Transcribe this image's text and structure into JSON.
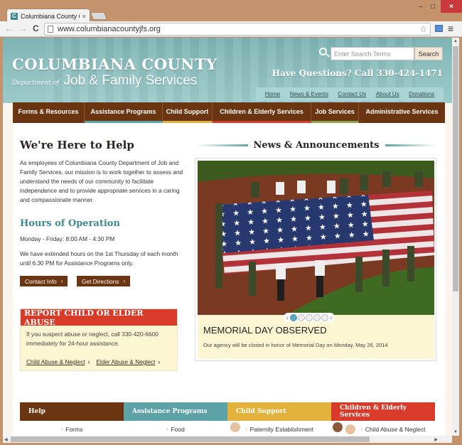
{
  "browser": {
    "tab_title": "Columbiana County Ohio",
    "tab_favicon": "C",
    "close_glyph": "×",
    "url": "www.columbianacountyjfs.org",
    "back_glyph": "←",
    "forward_glyph": "→",
    "reload_glyph": "C",
    "star_glyph": "☆",
    "menu_glyph": "≡",
    "min_glyph": "–",
    "max_glyph": "□",
    "winclose_glyph": "×",
    "icons": [
      "back-icon",
      "forward-icon",
      "reload-icon",
      "page-icon",
      "star-icon",
      "extension-icon",
      "menu-icon"
    ]
  },
  "header": {
    "title": "COLUMBIANA COUNTY",
    "subtitle_small": "Department of",
    "subtitle_large": "Job & Family Services",
    "search_placeholder": "Enter Search Terms",
    "search_button": "Search",
    "phone": "Have Questions? Call 330-424-1471",
    "utility_nav": [
      "Home",
      "News & Events",
      "Contact Us",
      "About Us",
      "Donations"
    ]
  },
  "main_nav": [
    {
      "label": "Forms & Resources",
      "accent": "#6a3510"
    },
    {
      "label": "Assistance Programs",
      "accent": "#5da2a6"
    },
    {
      "label": "Child Support",
      "accent": "#e3b23c"
    },
    {
      "label": "Children & Elderly Services",
      "accent": "#d93b2a"
    },
    {
      "label": "Job Services",
      "accent": "#8aa64a"
    },
    {
      "label": "Administrative Services",
      "accent": "#6a3510"
    }
  ],
  "help": {
    "title": "We're Here to Help",
    "text": "As employees of Columbiana County Department of Job and Family Services, our mission is to work together to assess and understand the needs of our community to facilitate independence and to provide appropriate services in a caring and compassionate manner."
  },
  "hours": {
    "title": "Hours of Operation",
    "schedule": "Monday - Friday: 8:00 AM - 4:30 PM",
    "extended": "We have extended hours on the 1st Thursday of each month until 6:30 PM for Assistance Programs only.",
    "buttons": [
      "Contact Info",
      "Get Directions"
    ],
    "chevron": "›"
  },
  "abuse": {
    "title": "REPORT CHILD OR ELDER ABUSE",
    "text": "If you suspect abuse or neglect, call 330-420-6600 immediately for 24-hour assistance.",
    "links": [
      "Child Abuse & Neglect",
      "Elder Abuse & Neglect"
    ],
    "chevron": "›"
  },
  "news": {
    "title": "News & Announcements",
    "slide_title": "MEMORIAL DAY OBSERVED",
    "slide_text": "Our agency will be closed in honor of Memorial Day on Monday, May 26, 2014",
    "slide_count": 5,
    "active_slide": 1,
    "prev_glyph": "‹",
    "next_glyph": "›",
    "image_description": "Service members and sailors holding a large American flag on a baseball field"
  },
  "quick_links": [
    {
      "heading": "Help",
      "color": "#6a3510",
      "item": "Forms"
    },
    {
      "heading": "Assistance Programs",
      "color": "#5da2a6",
      "item": "Food"
    },
    {
      "heading": "Child Support",
      "color": "#e3b23c",
      "item": "Paternity Establishment"
    },
    {
      "heading": "Children & Elderly Services",
      "color": "#d93b2a",
      "item": "Child Abuse & Neglect"
    }
  ]
}
